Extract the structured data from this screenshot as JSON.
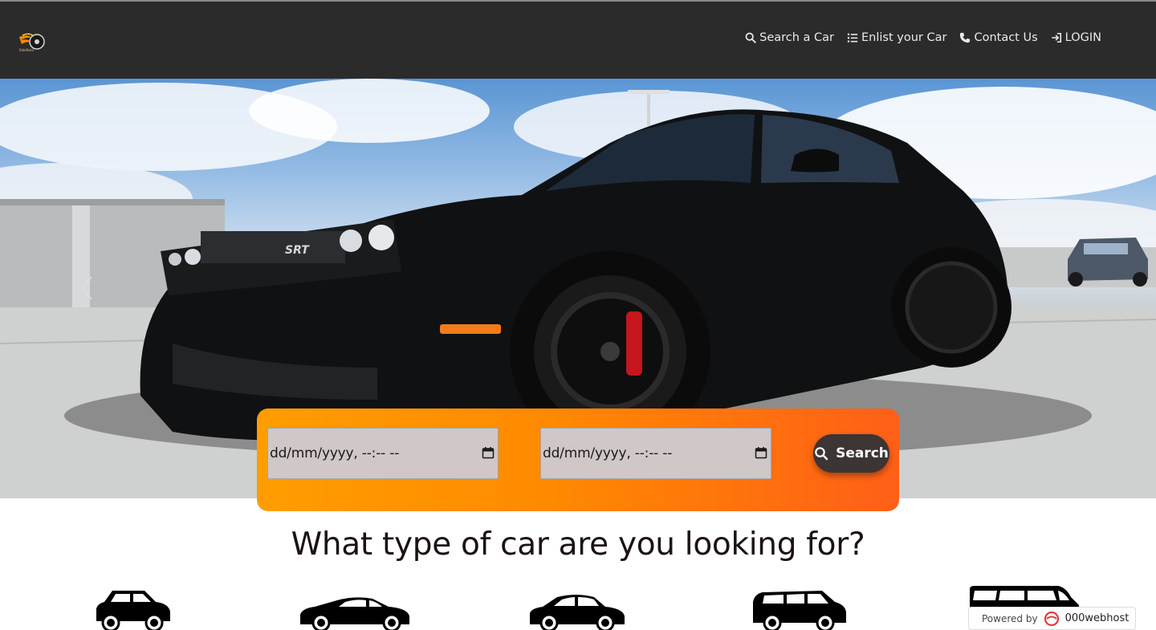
{
  "nav": {
    "logo_text": "RideRent",
    "items": [
      {
        "label": "Search a Car",
        "icon": "search-icon"
      },
      {
        "label": "Enlist your Car",
        "icon": "list-icon"
      },
      {
        "label": "Contact Us",
        "icon": "phone-icon"
      },
      {
        "label": "LOGIN",
        "icon": "login-icon"
      }
    ]
  },
  "hero": {
    "car_badge": "SRT"
  },
  "search": {
    "pickup_value": "dd/mm/yyyy, --:-- --",
    "dropoff_value": "dd/mm/yyyy, --:-- --",
    "button_label": "Search"
  },
  "section": {
    "title": "What type of car are you looking for?",
    "car_types": [
      "hatchback-icon",
      "coupe-icon",
      "sedan-icon",
      "suv-icon",
      "van-icon"
    ]
  },
  "footer_badge": {
    "label": "Powered by",
    "brand": "000webhost"
  },
  "colors": {
    "header_bg": "#2b2b2b",
    "panel_start": "#ff9d00",
    "panel_end": "#ff5f17",
    "button_bg": "#3d3434",
    "input_bg": "#d0c7c7"
  }
}
